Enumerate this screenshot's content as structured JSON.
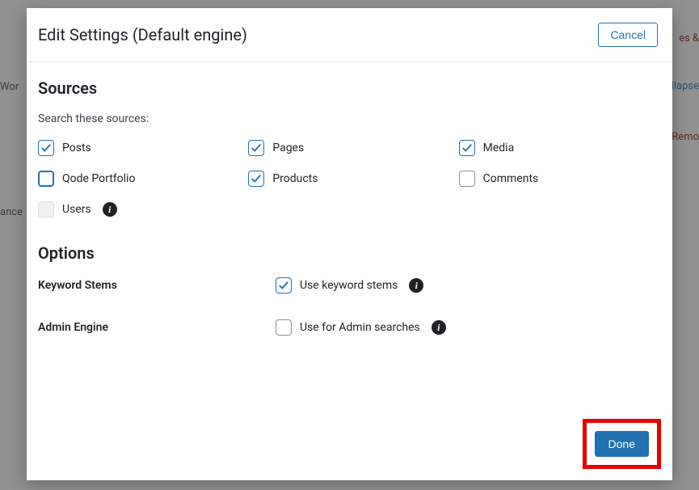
{
  "modal": {
    "title": "Edit Settings (Default engine)",
    "cancel": "Cancel",
    "done": "Done"
  },
  "sources": {
    "heading": "Sources",
    "subtext": "Search these sources:",
    "items": {
      "posts": "Posts",
      "pages": "Pages",
      "media": "Media",
      "qode": "Qode Portfolio",
      "products": "Products",
      "comments": "Comments",
      "users": "Users"
    }
  },
  "options": {
    "heading": "Options",
    "keyword_stems_label": "Keyword Stems",
    "keyword_stems_check": "Use keyword stems",
    "admin_engine_label": "Admin Engine",
    "admin_engine_check": "Use for Admin searches"
  },
  "bg": {
    "left1": "Wor",
    "left2": "ance",
    "right_top": "es &",
    "right1": "llapse",
    "right2": "Remo"
  }
}
